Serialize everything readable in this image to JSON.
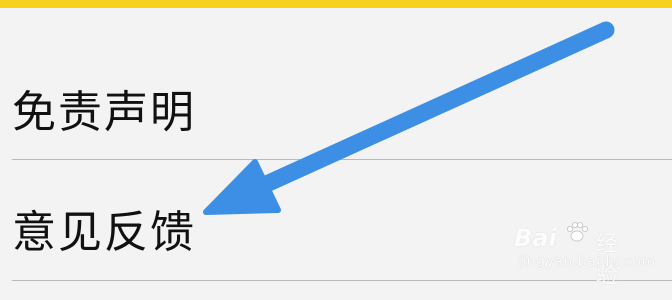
{
  "menu": {
    "items": [
      {
        "label": "免责声明"
      },
      {
        "label": "意见反馈"
      }
    ]
  },
  "watermark": {
    "brand": "Bai",
    "brand_suffix": "经验",
    "url": "jingyan.baidu.com"
  },
  "colors": {
    "top_bar": "#f5d21e",
    "background": "#f3f3f3",
    "divider": "#b9b9b9",
    "arrow": "#3d8fe6",
    "text": "#111111"
  },
  "icons": {
    "annotation_arrow": "arrow-pointer",
    "watermark_logo": "paw-icon"
  }
}
